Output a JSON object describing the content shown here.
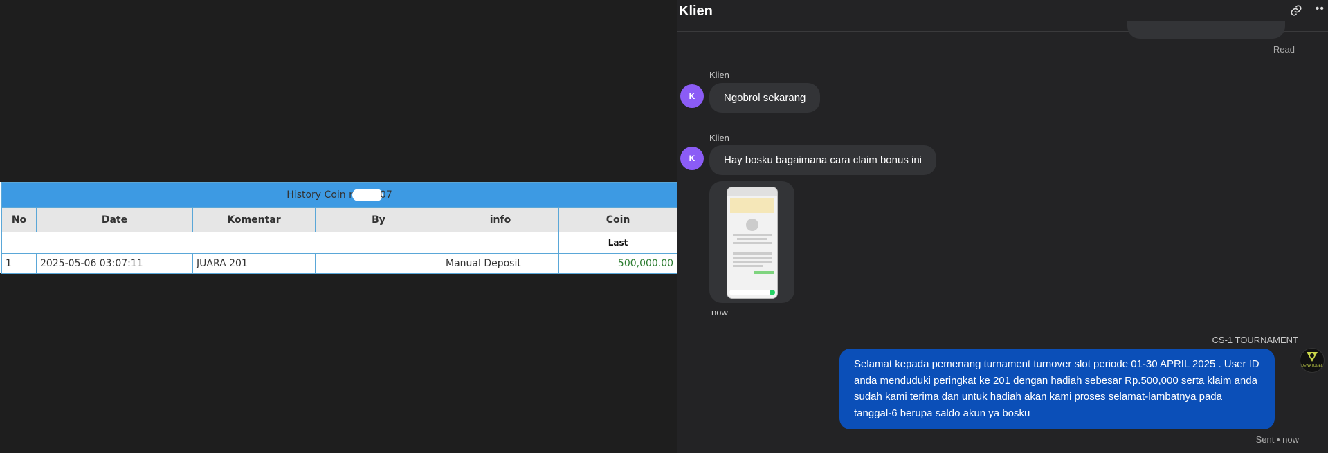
{
  "history": {
    "title_prefix": "History Coin n",
    "title_suffix": "07",
    "columns": [
      "No",
      "Date",
      "Komentar",
      "By",
      "info",
      "Coin"
    ],
    "sub_header": "Last",
    "rows": [
      {
        "no": "1",
        "date": "2025-05-06 03:07:11",
        "komentar": "JUARA 201",
        "by": "",
        "info": "Manual Deposit",
        "coin": "500,000.00"
      }
    ]
  },
  "chat": {
    "title": "Klien",
    "link_icon": "link-icon",
    "more_icon": "more-options-icon",
    "read_label": "Read",
    "messages": [
      {
        "sender": "Klien",
        "avatar": "K",
        "text": "Ngobrol sekarang"
      },
      {
        "sender": "Klien",
        "avatar": "K",
        "text": "Hay bosku bagaimana cara claim bonus ini"
      }
    ],
    "image_time": "now",
    "agent": {
      "name": "CS-1 TOURNAMENT",
      "message": "Selamat kepada pemenang turnament turnover slot periode 01-30 APRIL 2025 . User ID anda menduduki peringkat ke 201 dengan hadiah sebesar Rp.500,000 serta klaim anda sudah kami terima dan untuk hadiah akan kami proses selamat-lambatnya pada tanggal-6 berupa saldo akun ya bosku",
      "status": "Sent • now",
      "logo_text": "DEWATOGEL"
    }
  },
  "colors": {
    "table_header": "#3d9ae3",
    "coin_green": "#2e7d32",
    "avatar_purple": "#8b5cf6",
    "outgoing_bubble": "#0b4fb8"
  }
}
